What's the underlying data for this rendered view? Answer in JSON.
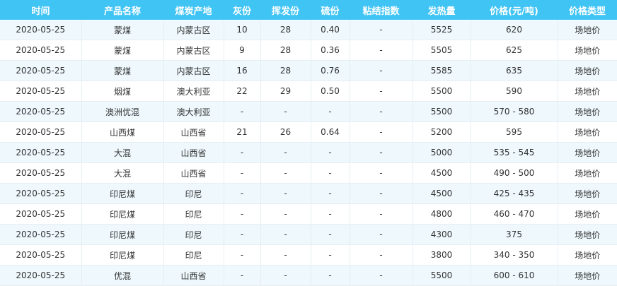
{
  "table": {
    "headers": [
      "时间",
      "产品名称",
      "煤炭产地",
      "灰份",
      "挥发份",
      "硫份",
      "粘结指数",
      "发热量",
      "价格(元/吨)",
      "价格类型"
    ],
    "rows": [
      [
        "2020-05-25",
        "蒙煤",
        "内蒙古区",
        "10",
        "28",
        "0.40",
        "-",
        "5525",
        "620",
        "场地价"
      ],
      [
        "2020-05-25",
        "蒙煤",
        "内蒙古区",
        "9",
        "28",
        "0.36",
        "-",
        "5505",
        "625",
        "场地价"
      ],
      [
        "2020-05-25",
        "蒙煤",
        "内蒙古区",
        "16",
        "28",
        "0.76",
        "-",
        "5585",
        "635",
        "场地价"
      ],
      [
        "2020-05-25",
        "烟煤",
        "澳大利亚",
        "22",
        "29",
        "0.50",
        "-",
        "5500",
        "590",
        "场地价"
      ],
      [
        "2020-05-25",
        "澳洲优混",
        "澳大利亚",
        "-",
        "-",
        "-",
        "-",
        "5500",
        "570 - 580",
        "场地价"
      ],
      [
        "2020-05-25",
        "山西煤",
        "山西省",
        "21",
        "26",
        "0.64",
        "-",
        "5200",
        "595",
        "场地价"
      ],
      [
        "2020-05-25",
        "大混",
        "山西省",
        "-",
        "-",
        "-",
        "-",
        "5000",
        "535 - 545",
        "场地价"
      ],
      [
        "2020-05-25",
        "大混",
        "山西省",
        "-",
        "-",
        "-",
        "-",
        "4500",
        "490 - 500",
        "场地价"
      ],
      [
        "2020-05-25",
        "印尼煤",
        "印尼",
        "-",
        "-",
        "-",
        "-",
        "4500",
        "425 - 435",
        "场地价"
      ],
      [
        "2020-05-25",
        "印尼煤",
        "印尼",
        "-",
        "-",
        "-",
        "-",
        "4800",
        "460 - 470",
        "场地价"
      ],
      [
        "2020-05-25",
        "印尼煤",
        "印尼",
        "-",
        "-",
        "-",
        "-",
        "4300",
        "375",
        "场地价"
      ],
      [
        "2020-05-25",
        "印尼煤",
        "印尼",
        "-",
        "-",
        "-",
        "-",
        "3800",
        "340 - 350",
        "场地价"
      ],
      [
        "2020-05-25",
        "优混",
        "山西省",
        "-",
        "-",
        "-",
        "-",
        "5500",
        "600 - 610",
        "场地价"
      ]
    ]
  }
}
